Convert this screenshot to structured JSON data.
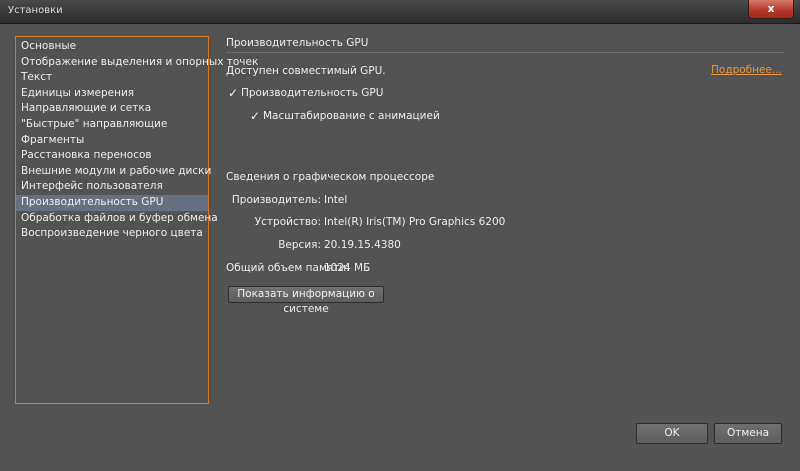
{
  "window": {
    "title": "Установки",
    "close_glyph": "x"
  },
  "sidebar": {
    "items": [
      {
        "label": "Основные"
      },
      {
        "label": "Отображение выделения и опорных точек"
      },
      {
        "label": "Текст"
      },
      {
        "label": "Единицы измерения"
      },
      {
        "label": "Направляющие и сетка"
      },
      {
        "label": "\"Быстрые\" направляющие"
      },
      {
        "label": "Фрагменты"
      },
      {
        "label": "Расстановка переносов"
      },
      {
        "label": "Внешние модули и рабочие диски"
      },
      {
        "label": "Интерфейс пользователя"
      },
      {
        "label": "Производительность GPU"
      },
      {
        "label": "Обработка файлов и буфер обмена"
      },
      {
        "label": "Воспроизведение черного цвета"
      }
    ],
    "selected_index": 10
  },
  "gpu": {
    "section_title": "Производительность GPU",
    "compatible_text": "Доступен совместимый GPU.",
    "more_link": "Подробнее...",
    "gpu_performance": {
      "label": "Производительность GPU",
      "checked": true
    },
    "animated_zoom": {
      "label": "Масштабирование с анимацией",
      "checked": true
    }
  },
  "gpu_info": {
    "heading": "Сведения о графическом процессоре",
    "vendor_label": "Производитель:",
    "vendor_value": "Intel",
    "device_label": "Устройство:",
    "device_value": "Intel(R) Iris(TM) Pro Graphics 6200",
    "version_label": "Версия:",
    "version_value": "20.19.15.4380",
    "memory_label": "Общий объем памяти:",
    "memory_value": "1024 МБ",
    "sysinfo_button": "Показать информацию о системе"
  },
  "footer": {
    "ok": "OK",
    "cancel": "Отмена"
  },
  "colors": {
    "accent": "#d1762b",
    "link": "#e8953f",
    "selection": "#67707e",
    "background": "#535353"
  }
}
